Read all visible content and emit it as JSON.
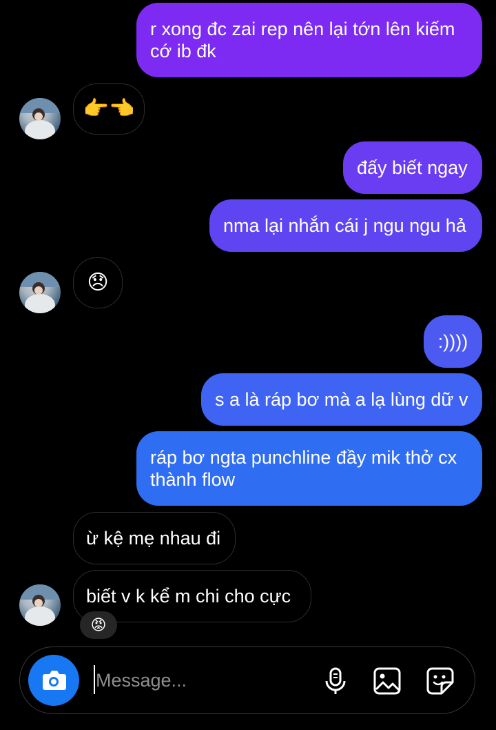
{
  "conversation": {
    "messages": [
      {
        "id": "m1",
        "direction": "sent",
        "text": "r xong đc zai rep nên lại tớn lên kiếm\ncớ ib đk"
      },
      {
        "id": "m2",
        "direction": "received",
        "emoji": "👉👈"
      },
      {
        "id": "m3",
        "direction": "sent",
        "text": "đấy biết ngay"
      },
      {
        "id": "m4",
        "direction": "sent",
        "text": "nma lại nhắn cái j ngu ngu hả"
      },
      {
        "id": "m5",
        "direction": "received",
        "emoji": "😞"
      },
      {
        "id": "m6",
        "direction": "sent",
        "text": ":))))"
      },
      {
        "id": "m7",
        "direction": "sent",
        "text": "s a là ráp bơ mà a lạ lùng dữ v"
      },
      {
        "id": "m8",
        "direction": "sent",
        "text": "ráp bơ ngta punchline đầy mik thở cx\nthành flow"
      },
      {
        "id": "m9",
        "direction": "received",
        "text": "ừ kệ mẹ nhau đi"
      },
      {
        "id": "m10",
        "direction": "received",
        "text": "biết v k kể m chi cho cực",
        "reaction": "😡"
      }
    ]
  },
  "composer": {
    "placeholder": "Message...",
    "camera_icon": "camera-icon",
    "mic_icon": "microphone-icon",
    "gallery_icon": "gallery-icon",
    "sticker_icon": "sticker-icon"
  },
  "colors": {
    "sent_purple": "#7a2ff2",
    "sent_blue": "#2f6df2",
    "received_border": "#2e2e2e",
    "camera_button": "#1877f2"
  }
}
